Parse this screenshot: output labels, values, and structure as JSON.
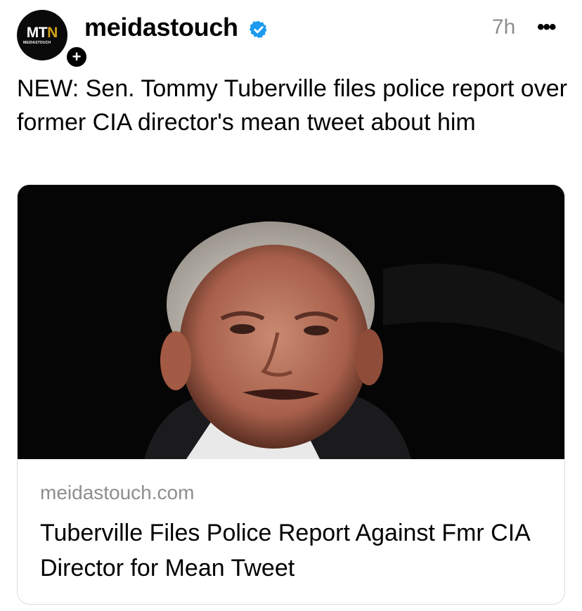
{
  "post": {
    "avatar": {
      "logo_text": "MT",
      "logo_accent": "N",
      "logo_subtext": "MEIDASTOUCH",
      "follow_symbol": "+"
    },
    "username": "meidastouch",
    "verified_icon": "verified-badge-icon",
    "time": "7h",
    "more_icon": "•••",
    "text": "NEW: Sen. Tommy Tuberville files police report over former CIA director's mean tweet about him"
  },
  "link_card": {
    "domain": "meidastouch.com",
    "title": "Tuberville Files Police Report Against Fmr CIA Director for Mean Tweet"
  },
  "colors": {
    "verified": "#1d9bf0",
    "muted_text": "#8e8e8e",
    "logo_accent": "#d4a017",
    "card_border": "#dcdcdc"
  }
}
